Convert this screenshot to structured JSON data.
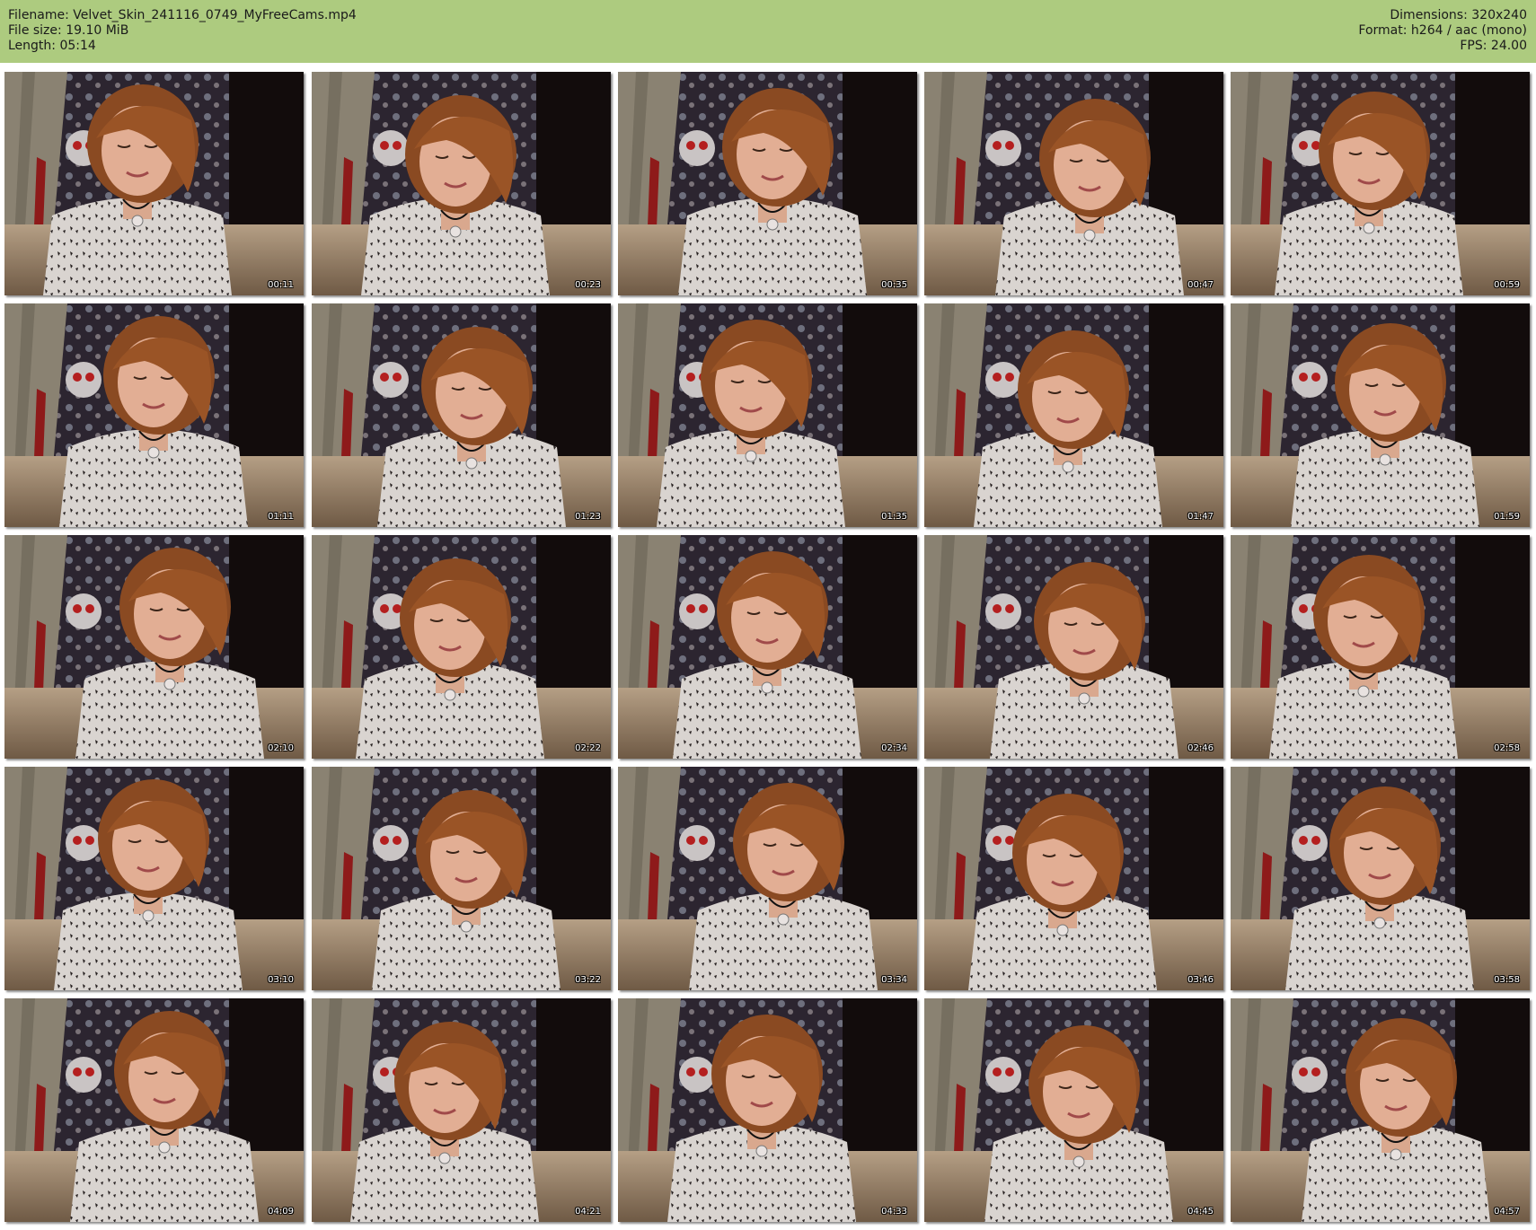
{
  "header": {
    "filename": "Filename: Velvet_Skin_241116_0749_MyFreeCams.mp4",
    "file_size": "File size: 19.10 MiB",
    "length": "Length: 05:14",
    "dimensions": "Dimensions: 320x240",
    "format": "Format: h264 / aac (mono)",
    "fps": "FPS: 24.00"
  },
  "colors": {
    "header_bg": "#adcb7f",
    "page_bg": "#ffffff"
  },
  "thumbnails": [
    {
      "timestamp": "00:11"
    },
    {
      "timestamp": "00:23"
    },
    {
      "timestamp": "00:35"
    },
    {
      "timestamp": "00:47"
    },
    {
      "timestamp": "00:59"
    },
    {
      "timestamp": "01:11"
    },
    {
      "timestamp": "01:23"
    },
    {
      "timestamp": "01:35"
    },
    {
      "timestamp": "01:47"
    },
    {
      "timestamp": "01:59"
    },
    {
      "timestamp": "02:10"
    },
    {
      "timestamp": "02:22"
    },
    {
      "timestamp": "02:34"
    },
    {
      "timestamp": "02:46"
    },
    {
      "timestamp": "02:58"
    },
    {
      "timestamp": "03:10"
    },
    {
      "timestamp": "03:22"
    },
    {
      "timestamp": "03:34"
    },
    {
      "timestamp": "03:46"
    },
    {
      "timestamp": "03:58"
    },
    {
      "timestamp": "04:09"
    },
    {
      "timestamp": "04:21"
    },
    {
      "timestamp": "04:33"
    },
    {
      "timestamp": "04:45"
    },
    {
      "timestamp": "04:57"
    }
  ]
}
